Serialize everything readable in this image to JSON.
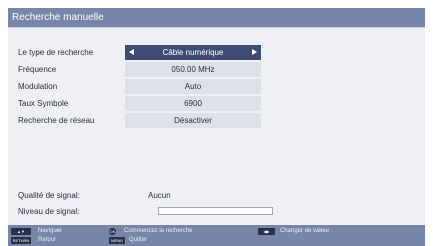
{
  "screen": {
    "title": "Recherche manuelle"
  },
  "form": {
    "rows": [
      {
        "label": "Le type de recherche",
        "value": "Câble numérique"
      },
      {
        "label": "Fréquence",
        "value": "050.00 MHz"
      },
      {
        "label": "Modulation",
        "value": "Auto"
      },
      {
        "label": "Taux Symbole",
        "value": "6900"
      },
      {
        "label": "Recherche de réseau",
        "value": "Désactiver"
      }
    ]
  },
  "signal": {
    "quality_label": "Qualité de signal:",
    "quality_value": "Aucun",
    "level_label": "Niveau de signal:",
    "level_fraction": 0
  },
  "hints": {
    "navigate": "Naviguer",
    "back": "Retour",
    "start_search": "Commencez la recherche",
    "quit": "Quitter",
    "change_value": "Changer de valeur",
    "back_key": "RETURN",
    "menu_key": "MENU",
    "ok_key": "OK"
  },
  "colors": {
    "title_bar": "#7786a8",
    "panel": "#eef0f4",
    "value_box": "#dde1ea",
    "active_box": "#3e4c73",
    "signal_fill": "#5fa8e8"
  }
}
